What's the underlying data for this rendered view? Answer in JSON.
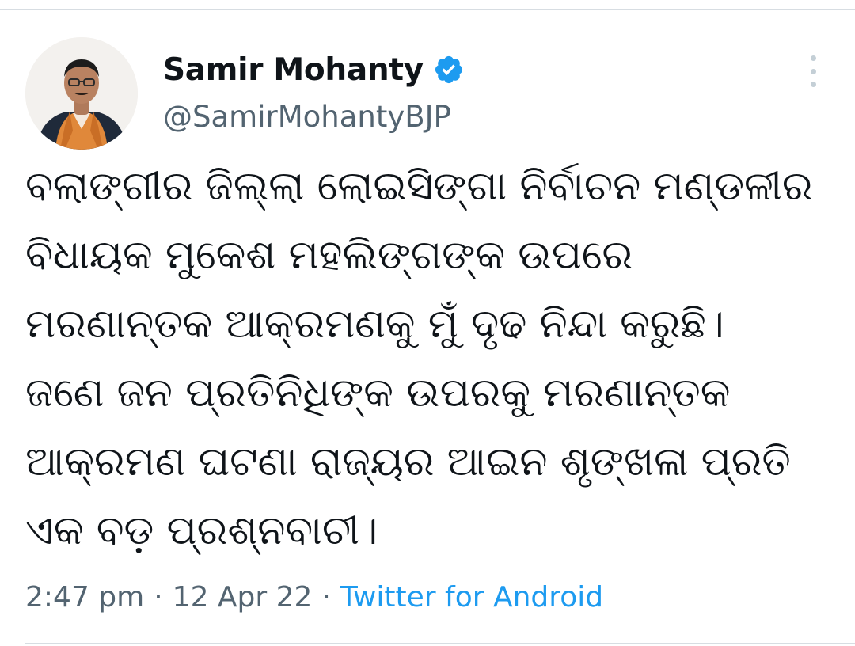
{
  "tweet": {
    "author": {
      "display_name": "Samir Mohanty",
      "handle": "@SamirMohantyBJP",
      "verified": true,
      "verified_badge_color": "#1d9bf0"
    },
    "text_lines": [
      "ବଲାଙ୍ଗୀର ଜିଲ୍ଲା ଲୋଇସିଙ୍ଗା ନିର୍ବାଚନ ମଣ୍ଡଳୀର",
      "ବିଧାୟକ ମୁକେଶ ମହଲିଙ୍ଗଙ୍କ ଉପରେ",
      "ମରଣାନ୍ତକ ଆକ୍ରମଣକୁ ମୁଁ ଦୃଢ ନିନ୍ଦା କରୁଛି।",
      "ଜଣେ ଜନ ପ୍ରତିନିଧିଙ୍କ ଉପରକୁ ମରଣାନ୍ତକ",
      "ଆକ୍ରମଣ ଘଟଣା ରାଜ୍ୟର ଆଇନ ଶୃଙ୍ଖଳା ପ୍ରତି",
      "ଏକ ବଡ଼ ପ୍ରଶ୍ନବାଚୀ।"
    ],
    "meta": {
      "time": "2:47 pm",
      "separator": "·",
      "date": "12 Apr 22",
      "source": "Twitter for Android"
    }
  },
  "icons": {
    "verified": "verified-badge-icon",
    "more": "more-options-icon"
  },
  "colors": {
    "text_primary": "#0f1419",
    "text_secondary": "#536471",
    "link": "#1d9bf0",
    "divider": "#d7dde2"
  }
}
